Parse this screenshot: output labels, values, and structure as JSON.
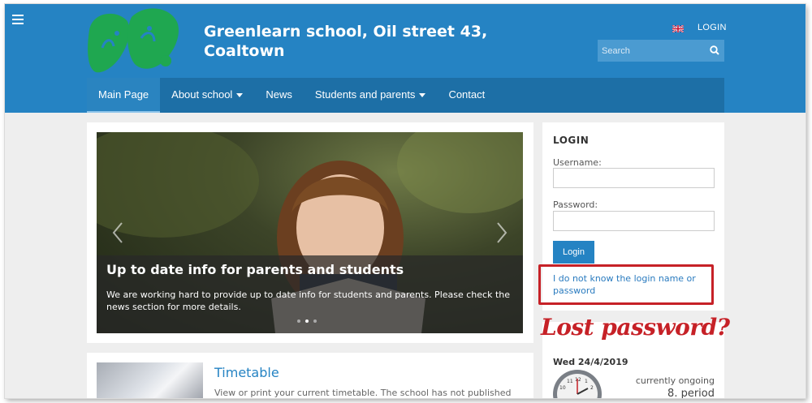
{
  "header": {
    "school_name": "Greenlearn school, Oil street 43, Coaltown",
    "login_link": "LOGIN",
    "search_placeholder": "Search"
  },
  "nav": {
    "items": [
      {
        "label": "Main Page",
        "active": true,
        "dropdown": false
      },
      {
        "label": "About school",
        "active": false,
        "dropdown": true
      },
      {
        "label": "News",
        "active": false,
        "dropdown": false
      },
      {
        "label": "Students and parents",
        "active": false,
        "dropdown": true
      },
      {
        "label": "Contact",
        "active": false,
        "dropdown": false
      }
    ]
  },
  "hero": {
    "title": "Up to date info for parents and students",
    "text": "We are working hard to provide up to date info for students and parents. Please check the news section for more details."
  },
  "login": {
    "heading": "LOGIN",
    "username_label": "Username:",
    "password_label": "Password:",
    "button": "Login",
    "forgot_link": "I do not know the login name or password"
  },
  "annotation": {
    "text": "Lost password?",
    "color": "#c62127"
  },
  "info": {
    "date": "Wed 24/4/2019",
    "ongoing_label": "currently ongoing",
    "period": "8. period"
  },
  "timetable": {
    "title": "Timetable",
    "text": "View or print your current timetable. The school has not published the"
  },
  "colors": {
    "header": "#2583c3",
    "nav": "#1d6fa6",
    "logo_green": "#1fa750"
  }
}
